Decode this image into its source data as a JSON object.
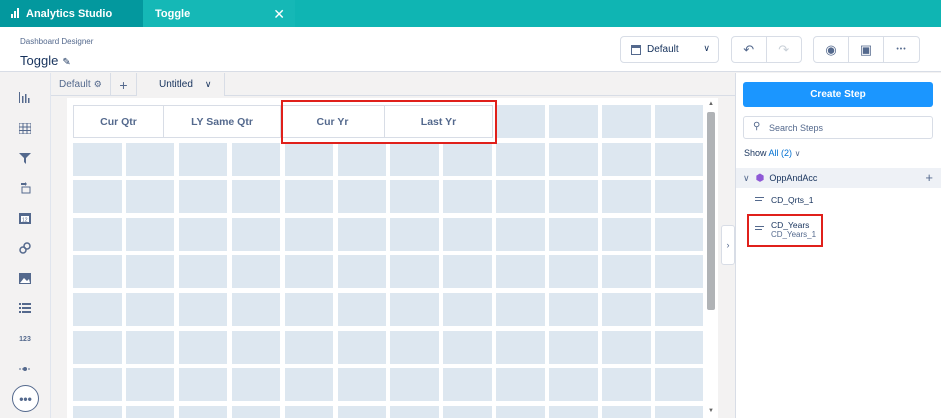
{
  "app": {
    "tab_label": "Analytics Studio",
    "doc_tab_label": "Toggle",
    "close_glyph": "✕"
  },
  "header": {
    "subtitle": "Dashboard Designer",
    "title": "Toggle",
    "layout_select": "Default",
    "undo_icon": "undo-icon",
    "redo_icon": "redo-icon",
    "preview_icon": "eye-icon",
    "save_icon": "save-icon",
    "more_glyph": "•••"
  },
  "sidebar": {
    "items": [
      "chart-icon",
      "table-icon",
      "filter-icon",
      "toggle-icon",
      "date-icon",
      "link-icon",
      "image-icon",
      "list-icon",
      "number-icon",
      "range-icon"
    ],
    "number_glyph": "123",
    "more_glyph": "•••"
  },
  "pages": {
    "default_label": "Default",
    "add_glyph": "+",
    "current": "Untitled"
  },
  "toggle_widget": {
    "options": [
      "Cur Qtr",
      "LY Same Qtr",
      "Cur Yr",
      "Last Yr"
    ]
  },
  "panel": {
    "create_button": "Create Step",
    "search_placeholder": "Search Steps",
    "show_prefix": "Show",
    "show_link": "All (2)",
    "dataset": "OppAndAcc",
    "steps": [
      {
        "name": "CD_Qrts_1",
        "sub": ""
      },
      {
        "name": "CD_Years",
        "sub": "CD_Years_1"
      }
    ]
  },
  "colors": {
    "accent": "#0fb5b3",
    "primary_button": "#1b96ff",
    "highlight": "#e0201b",
    "grid_cell": "#dde7f0"
  }
}
